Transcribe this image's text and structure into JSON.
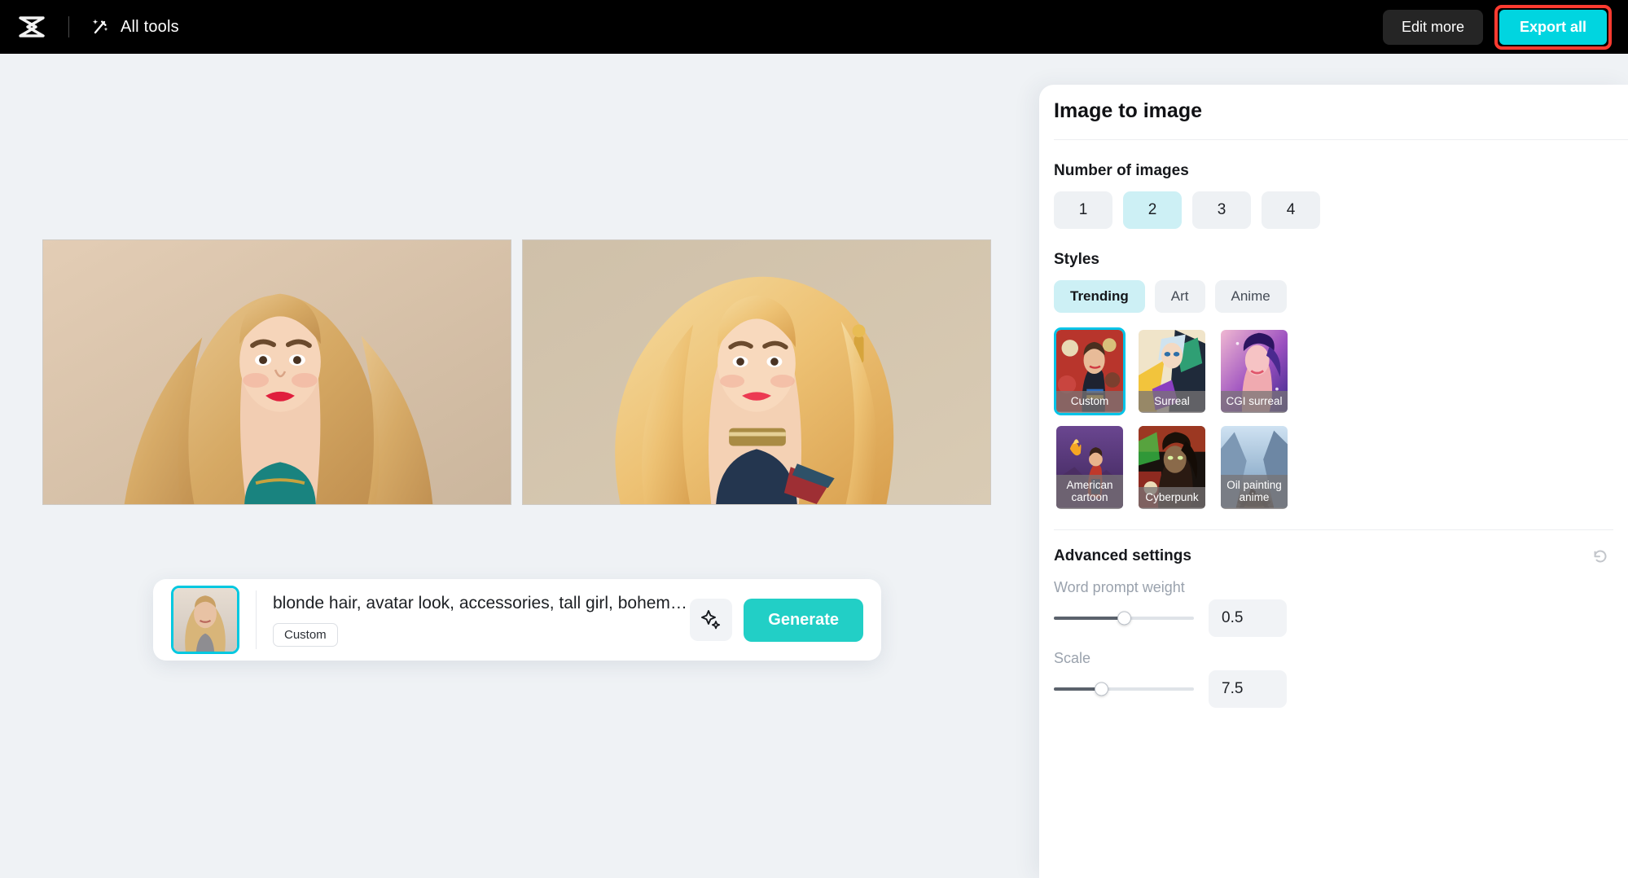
{
  "topbar": {
    "logo_icon": "capcut-logo-icon",
    "wand_icon": "magic-wand-icon",
    "all_tools_label": "All tools",
    "edit_more_label": "Edit more",
    "export_all_label": "Export all",
    "export_highlight_color": "#ff3b30",
    "export_button_color": "#00d5e0",
    "background_color": "#000000"
  },
  "canvas": {
    "background_color": "#eff2f5",
    "results": [
      {
        "alt": "blonde-woman-portrait-1"
      },
      {
        "alt": "blonde-woman-portrait-2"
      }
    ]
  },
  "prompt_bar": {
    "thumbnail_alt": "source-reference-photo",
    "prompt_text": "blonde hair, avatar look, accessories, tall girl, bohemian",
    "style_tag_label": "Custom",
    "magic_icon": "sparkles-icon",
    "generate_label": "Generate",
    "generate_color": "#22cfc6"
  },
  "panel": {
    "title": "Image to image",
    "number_of_images": {
      "label": "Number of images",
      "options": [
        "1",
        "2",
        "3",
        "4"
      ],
      "selected": "2",
      "selected_color": "#cdf0f5"
    },
    "styles": {
      "label": "Styles",
      "tabs": [
        {
          "label": "Trending",
          "active": true
        },
        {
          "label": "Art",
          "active": false
        },
        {
          "label": "Anime",
          "active": false
        }
      ],
      "cards": [
        {
          "label": "Custom",
          "selected": true
        },
        {
          "label": "Surreal",
          "selected": false
        },
        {
          "label": "CGI surreal",
          "selected": false
        },
        {
          "label": "American cartoon",
          "selected": false
        },
        {
          "label": "Cyberpunk",
          "selected": false
        },
        {
          "label": "Oil painting anime",
          "selected": false
        }
      ],
      "selected_border_color": "#00c4e8"
    },
    "advanced": {
      "title": "Advanced settings",
      "reset_icon": "reset-icon",
      "sliders": [
        {
          "label": "Word prompt weight",
          "value": "0.5",
          "percent": 50
        },
        {
          "label": "Scale",
          "value": "7.5",
          "percent": 34
        }
      ]
    }
  }
}
